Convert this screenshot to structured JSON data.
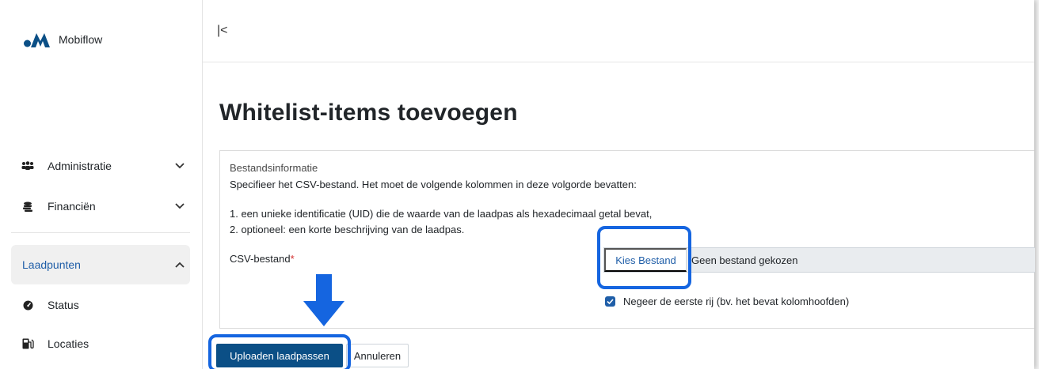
{
  "sidebar": {
    "brand": "Mobiflow",
    "items": [
      {
        "label": "Administratie",
        "icon": "users-icon"
      },
      {
        "label": "Financiën",
        "icon": "coins-icon"
      },
      {
        "label": "Laadpunten",
        "icon": "none"
      },
      {
        "label": "Status",
        "icon": "gauge-icon"
      },
      {
        "label": "Locaties",
        "icon": "charging-station-icon"
      }
    ]
  },
  "topbar": {
    "collapse_glyph": "|<"
  },
  "main": {
    "title": "Whitelist-items toevoegen",
    "card": {
      "section_title": "Bestandsinformatie",
      "description": "Specifieer het CSV-bestand. Het moet de volgende kolommen in deze volgorde bevatten:",
      "list": [
        "1. een unieke identificatie (UID) die de waarde van de laadpas als hexadecimaal getal bevat,",
        "2. optioneel: een korte beschrijving van de laadpas."
      ],
      "csv_label": "CSV-bestand",
      "required_mark": "*",
      "file_button": "Kies Bestand",
      "file_status": "Geen bestand gekozen",
      "checkbox_label": "Negeer de eerste rij (bv. het bevat kolomhoofden)",
      "checkbox_checked": true
    },
    "buttons": {
      "upload": "Uploaden laadpassen",
      "cancel": "Annuleren"
    }
  },
  "colors": {
    "primary": "#0b4f86",
    "highlight": "#1565e0",
    "accent": "#1f5ea8"
  }
}
